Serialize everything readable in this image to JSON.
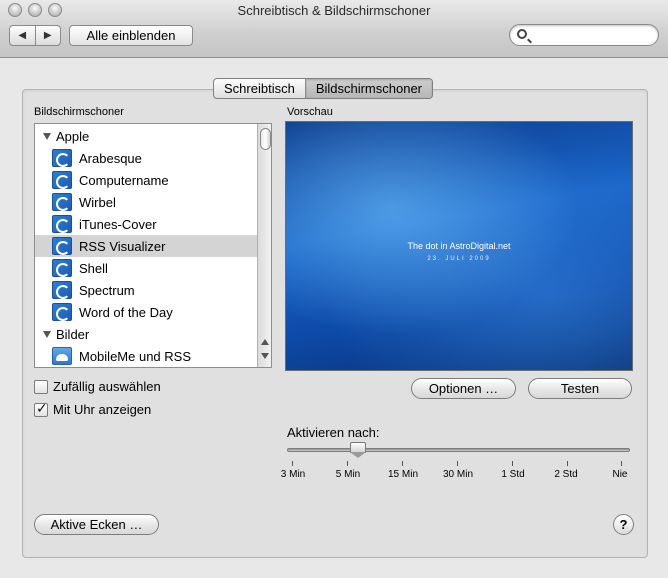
{
  "window": {
    "title": "Schreibtisch & Bildschirmschoner"
  },
  "toolbar": {
    "back_glyph": "◀",
    "forward_glyph": "▶",
    "show_all_label": "Alle einblenden",
    "search_placeholder": ""
  },
  "tabs": [
    {
      "label": "Schreibtisch",
      "selected": false
    },
    {
      "label": "Bildschirmschoner",
      "selected": true
    }
  ],
  "screensavers": {
    "heading": "Bildschirmschoner",
    "groups": [
      {
        "label": "Apple",
        "items": [
          "Arabesque",
          "Computername",
          "Wirbel",
          "iTunes-Cover",
          "RSS Visualizer",
          "Shell",
          "Spectrum",
          "Word of the Day"
        ]
      },
      {
        "label": "Bilder",
        "items": [
          "MobileMe und RSS"
        ]
      }
    ],
    "selected": "RSS Visualizer"
  },
  "preview": {
    "heading": "Vorschau",
    "line1": "The dot in AstroDigital.net",
    "line2": "23. JULI 2009"
  },
  "buttons": {
    "options": "Optionen …",
    "test": "Testen",
    "hot_corners": "Aktive Ecken …",
    "help": "?"
  },
  "checkboxes": {
    "random": {
      "label": "Zufällig auswählen",
      "checked": false
    },
    "clock": {
      "label": "Mit Uhr anzeigen",
      "checked": true
    }
  },
  "activate": {
    "label": "Aktivieren nach:",
    "ticks": [
      "3 Min",
      "5 Min",
      "15 Min",
      "30 Min",
      "1 Std",
      "2 Std",
      "Nie"
    ],
    "selected": "5 Min"
  },
  "icons": {
    "screensaver": "screensaver-swirl-icon",
    "pictures": "cloud-icon",
    "search": "magnifier-icon"
  }
}
